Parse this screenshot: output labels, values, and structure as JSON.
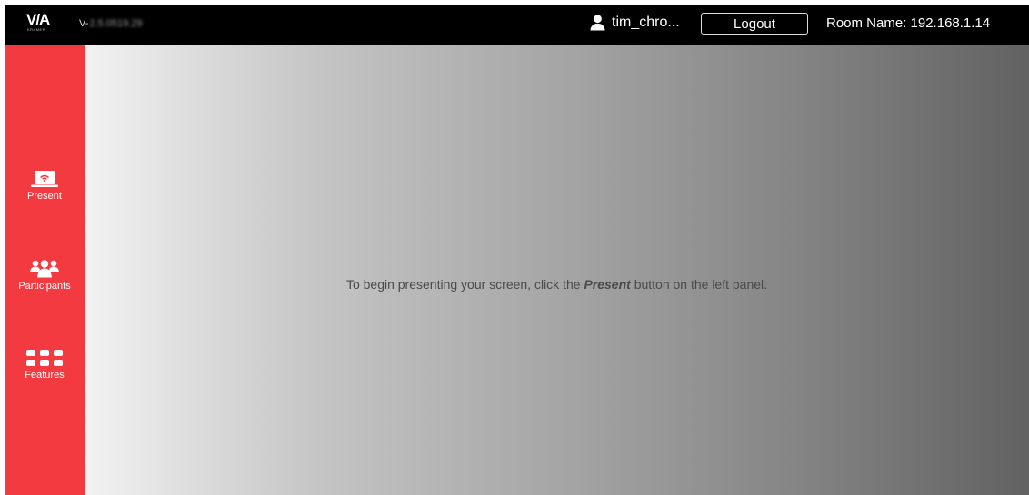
{
  "header": {
    "logo_text": "V/A",
    "logo_sub": "KRAMER",
    "version_prefix": "V-",
    "version_value": "2.5.0519.29",
    "username": "tim_chro...",
    "logout_label": "Logout",
    "room_name": "Room Name: 192.168.1.14"
  },
  "sidebar": {
    "items": [
      {
        "label": "Present",
        "icon": "laptop-wifi-icon"
      },
      {
        "label": "Participants",
        "icon": "participants-icon"
      },
      {
        "label": "Features",
        "icon": "grid-icon"
      }
    ]
  },
  "main": {
    "hint_before": "To begin presenting your screen, click the",
    "hint_bold": "Present",
    "hint_after": "button on the left panel."
  },
  "colors": {
    "topbar": "#000000",
    "sidebar": "#f33a40"
  }
}
